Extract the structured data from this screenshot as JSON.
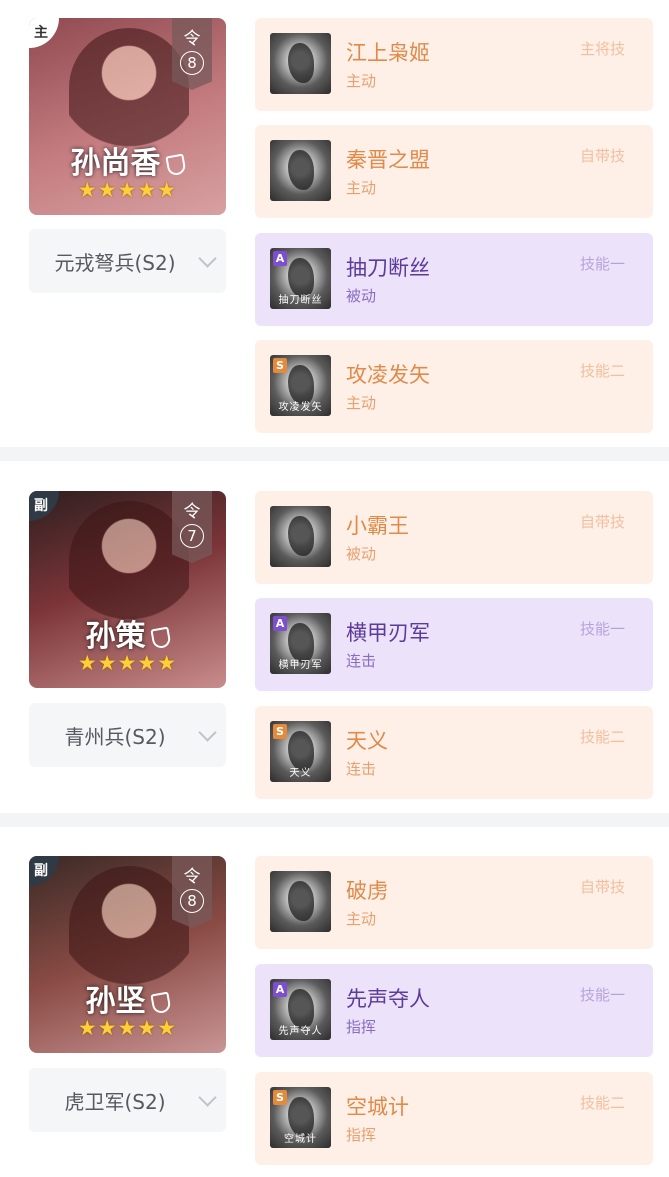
{
  "generals": [
    {
      "role": "主",
      "command_char": "令",
      "command_value": "8",
      "name": "孙尚香",
      "stars": "★★★★★",
      "troop": "元戎弩兵(S2)",
      "skills": [
        {
          "name": "江上枭姬",
          "type": "主动",
          "slot": "主将技",
          "grade": "",
          "caption": "",
          "color": "orange"
        },
        {
          "name": "秦晋之盟",
          "type": "主动",
          "slot": "自带技",
          "grade": "",
          "caption": "",
          "color": "orange"
        },
        {
          "name": "抽刀断丝",
          "type": "被动",
          "slot": "技能一",
          "grade": "A",
          "caption": "抽刀断丝",
          "color": "purple"
        },
        {
          "name": "攻凌发矢",
          "type": "主动",
          "slot": "技能二",
          "grade": "S",
          "caption": "攻凌发矢",
          "color": "orange"
        }
      ]
    },
    {
      "role": "副",
      "command_char": "令",
      "command_value": "7",
      "name": "孙策",
      "stars": "★★★★★",
      "troop": "青州兵(S2)",
      "skills": [
        {
          "name": "小霸王",
          "type": "被动",
          "slot": "自带技",
          "grade": "",
          "caption": "",
          "color": "orange"
        },
        {
          "name": "横甲刃军",
          "type": "连击",
          "slot": "技能一",
          "grade": "A",
          "caption": "横甲刃军",
          "color": "purple"
        },
        {
          "name": "天义",
          "type": "连击",
          "slot": "技能二",
          "grade": "S",
          "caption": "天义",
          "color": "orange"
        }
      ]
    },
    {
      "role": "副",
      "command_char": "令",
      "command_value": "8",
      "name": "孙坚",
      "stars": "★★★★★",
      "troop": "虎卫军(S2)",
      "skills": [
        {
          "name": "破虏",
          "type": "主动",
          "slot": "自带技",
          "grade": "",
          "caption": "",
          "color": "orange"
        },
        {
          "name": "先声夺人",
          "type": "指挥",
          "slot": "技能一",
          "grade": "A",
          "caption": "先声夺人",
          "color": "purple"
        },
        {
          "name": "空城计",
          "type": "指挥",
          "slot": "技能二",
          "grade": "S",
          "caption": "空城计",
          "color": "orange"
        }
      ]
    }
  ]
}
